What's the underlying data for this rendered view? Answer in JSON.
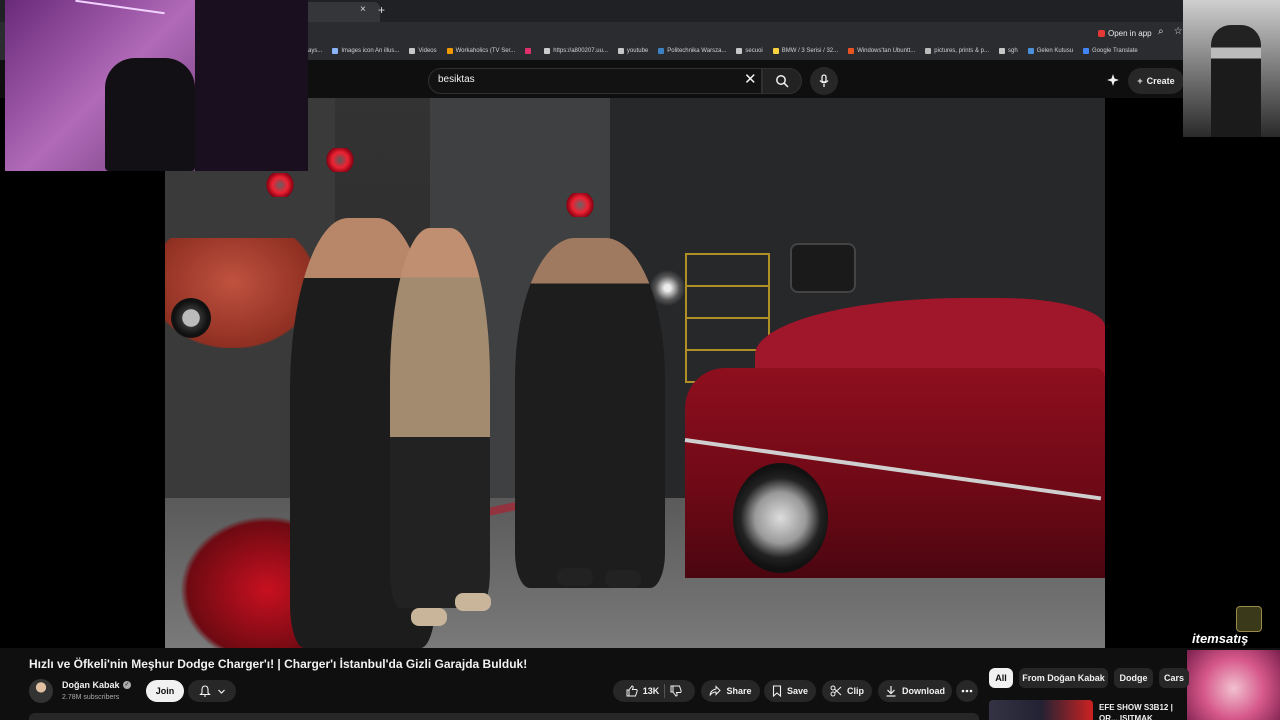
{
  "browser": {
    "tab_close": "×",
    "tab_new": "+",
    "open_in_app": "Open in app",
    "bookmarks": [
      "ays...",
      "Images icon An illus...",
      "Videos",
      "Workaholics (TV Ser...",
      "",
      "https://a800207.uu...",
      "youtube",
      "Politechnika Warsza...",
      "secuoi",
      "BMW / 3 Serisi / 32...",
      "Windows'tan Ubuntt...",
      "pictures, prints & p...",
      "sgh",
      "Gelen Kutusu",
      "Google Translate"
    ]
  },
  "header": {
    "search_value": "besiktas",
    "create_label": "Create"
  },
  "video": {
    "title": "Hızlı ve Öfkeli'nin Meşhur Dodge Charger'ı! | Charger'ı İstanbul'da Gizli Garajda Bulduk!",
    "channel": "Doğan Kabak",
    "subscribers": "2.78M subscribers",
    "join_label": "Join",
    "likes": "13K",
    "share_label": "Share",
    "save_label": "Save",
    "clip_label": "Clip",
    "download_label": "Download"
  },
  "watermark": {
    "text": "itemsatış"
  },
  "chips": [
    "All",
    "From Doğan Kabak",
    "Dodge",
    "Cars"
  ],
  "recommendation": {
    "title": "EFE SHOW S3B12 | OR... ISITMAK"
  },
  "colors": {
    "background": "#0f0f0f",
    "chip_bg": "#272727",
    "accent_red": "#e53935"
  }
}
